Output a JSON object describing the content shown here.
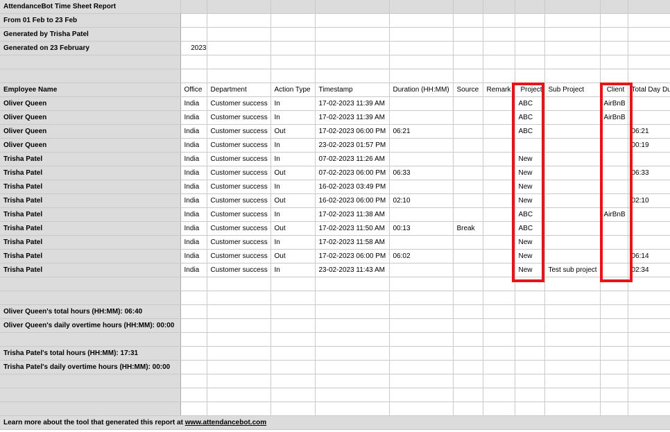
{
  "report": {
    "title": "AttendanceBot Time Sheet Report",
    "period": "From 01 Feb to 23 Feb",
    "generated_by": "Generated by Trisha Patel",
    "generated_on": "Generated on 23 February",
    "year": "2023"
  },
  "columns": [
    "Employee Name",
    "Office",
    "Department",
    "Action Type",
    "Timestamp",
    "Duration (HH:MM)",
    "Source",
    "Remark",
    "Project",
    "Sub Project",
    "Client",
    "Total Day Du"
  ],
  "rows": [
    [
      "Oliver Queen",
      "India",
      "Customer success",
      "In",
      "17-02-2023 11:39 AM",
      "",
      "",
      "",
      "ABC",
      "",
      "AirBnB",
      ""
    ],
    [
      "Oliver Queen",
      "India",
      "Customer success",
      "In",
      "17-02-2023 11:39 AM",
      "",
      "",
      "",
      "ABC",
      "",
      "AirBnB",
      ""
    ],
    [
      "Oliver Queen",
      "India",
      "Customer success",
      "Out",
      "17-02-2023 06:00 PM",
      "06:21",
      "",
      "",
      "ABC",
      "",
      "",
      "06:21"
    ],
    [
      "Oliver Queen",
      "India",
      "Customer success",
      "In",
      "23-02-2023 01:57 PM",
      "",
      "",
      "",
      "",
      "",
      "",
      "00:19"
    ],
    [
      "Trisha Patel",
      "India",
      "Customer success",
      "In",
      "07-02-2023 11:26 AM",
      "",
      "",
      "",
      "New",
      "",
      "",
      ""
    ],
    [
      "Trisha Patel",
      "India",
      "Customer success",
      "Out",
      "07-02-2023 06:00 PM",
      "06:33",
      "",
      "",
      "New",
      "",
      "",
      "06:33"
    ],
    [
      "Trisha Patel",
      "India",
      "Customer success",
      "In",
      "16-02-2023 03:49 PM",
      "",
      "",
      "",
      "New",
      "",
      "",
      ""
    ],
    [
      "Trisha Patel",
      "India",
      "Customer success",
      "Out",
      "16-02-2023 06:00 PM",
      "02:10",
      "",
      "",
      "New",
      "",
      "",
      "02:10"
    ],
    [
      "Trisha Patel",
      "India",
      "Customer success",
      "In",
      "17-02-2023 11:38 AM",
      "",
      "",
      "",
      "ABC",
      "",
      "AirBnB",
      ""
    ],
    [
      "Trisha Patel",
      "India",
      "Customer success",
      "Out",
      "17-02-2023 11:50 AM",
      "00:13",
      "Break",
      "",
      "ABC",
      "",
      "",
      ""
    ],
    [
      "Trisha Patel",
      "India",
      "Customer success",
      "In",
      "17-02-2023 11:58 AM",
      "",
      "",
      "",
      "New",
      "",
      "",
      ""
    ],
    [
      "Trisha Patel",
      "India",
      "Customer success",
      "Out",
      "17-02-2023 06:00 PM",
      "06:02",
      "",
      "",
      "New",
      "",
      "",
      "06:14"
    ],
    [
      "Trisha Patel",
      "India",
      "Customer success",
      "In",
      "23-02-2023 11:43 AM",
      "",
      "",
      "",
      "New",
      "Test sub project",
      "",
      "02:34"
    ]
  ],
  "summary": {
    "oliver_total": "Oliver Queen's total hours (HH:MM): 06:40",
    "oliver_overtime": "Oliver Queen's daily overtime hours (HH:MM): 00:00",
    "trisha_total": "Trisha Patel's total hours (HH:MM): 17:31",
    "trisha_overtime": "Trisha Patel's daily overtime hours (HH:MM): 00:00"
  },
  "footer": {
    "text": "Learn more about the tool that generated this report at ",
    "link": "www.attendancebot.com"
  },
  "highlight_color": "#e8141b"
}
